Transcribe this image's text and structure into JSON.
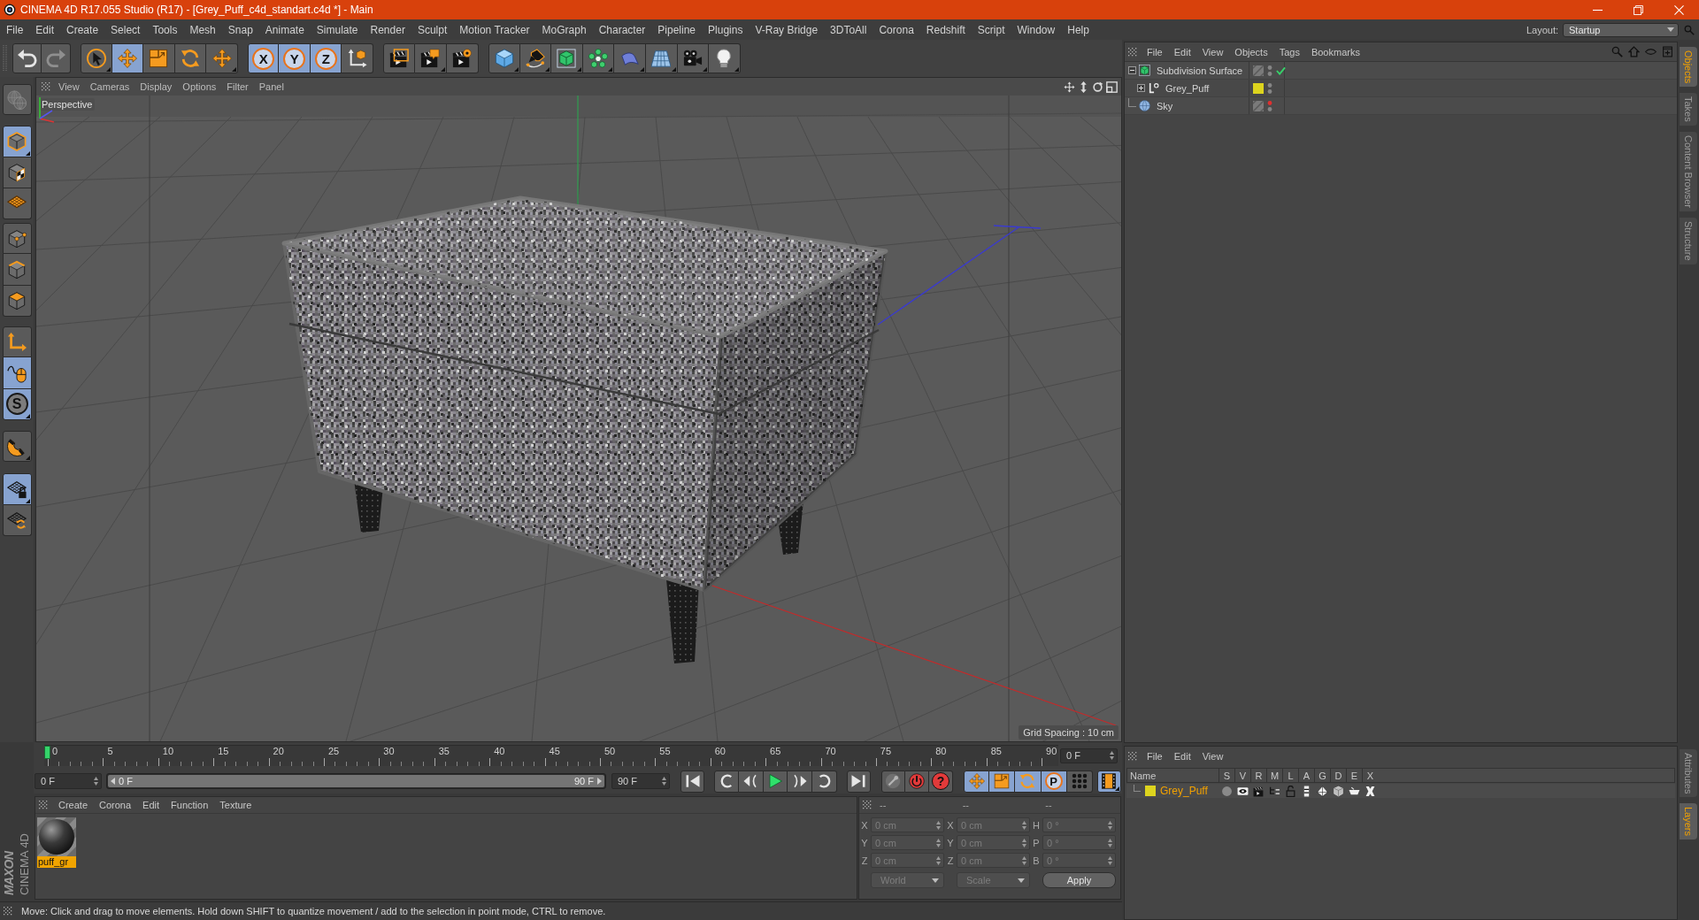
{
  "window": {
    "title": "CINEMA 4D R17.055 Studio (R17) - [Grey_Puff_c4d_standart.c4d *] - Main"
  },
  "menu_bar": {
    "items": [
      "File",
      "Edit",
      "Create",
      "Select",
      "Tools",
      "Mesh",
      "Snap",
      "Animate",
      "Simulate",
      "Render",
      "Sculpt",
      "Motion Tracker",
      "MoGraph",
      "Character",
      "Pipeline",
      "Plugins",
      "V-Ray Bridge",
      "3DToAll",
      "Corona",
      "Redshift",
      "Script",
      "Window",
      "Help"
    ],
    "layout_label": "Layout:",
    "layout_value": "Startup"
  },
  "toolbar": {
    "groups": [
      [
        {
          "active": false,
          "disabled": false
        },
        {
          "active": false,
          "disabled": true
        }
      ],
      [
        {
          "active": false
        },
        {
          "active": true
        },
        {
          "active": false
        },
        {
          "active": false
        },
        {
          "active": false
        }
      ],
      [
        {
          "glyph": "X",
          "active": true
        },
        {
          "glyph": "Y",
          "active": true
        },
        {
          "glyph": "Z",
          "active": true
        },
        {
          "active": false
        }
      ],
      [
        {
          "active": false
        },
        {
          "active": false
        },
        {
          "active": false
        }
      ],
      [
        {
          "active": false
        },
        {
          "active": false
        },
        {
          "active": false
        },
        {
          "active": false
        },
        {
          "active": false
        },
        {
          "active": false
        },
        {
          "active": false
        },
        {
          "active": false
        }
      ]
    ]
  },
  "left_toolbar": {
    "groups": [
      [
        {
          "active": false,
          "disabled": true
        }
      ],
      [
        {
          "active": true
        },
        {
          "active": false
        },
        {
          "active": false
        }
      ],
      [
        {
          "active": false
        },
        {
          "active": false
        },
        {
          "active": false
        }
      ],
      [
        {
          "active": false
        },
        {
          "active": true
        },
        {
          "glyph": "S",
          "active": true
        }
      ],
      [
        {
          "active": false
        }
      ],
      [
        {
          "active": true
        },
        {
          "active": false
        }
      ]
    ]
  },
  "viewport": {
    "menu": [
      "View",
      "Cameras",
      "Display",
      "Options",
      "Filter",
      "Panel"
    ],
    "camera": "Perspective",
    "grid_spacing": "Grid Spacing : 10 cm"
  },
  "object_manager": {
    "menu": [
      "File",
      "Edit",
      "View",
      "Objects",
      "Tags",
      "Bookmarks"
    ],
    "objects": [
      {
        "name": "Subdivision Surface",
        "kind": "subdivision",
        "expanded": true,
        "enabled": true,
        "hidden_in_editor": false,
        "children": [
          {
            "name": "Grey_Puff",
            "kind": "null",
            "expanded": false,
            "color": "#ddd41e",
            "hidden_in_editor": false
          }
        ]
      },
      {
        "name": "Sky",
        "kind": "sky",
        "hidden_in_editor": true
      }
    ]
  },
  "side_tabs": {
    "top": [
      {
        "label": "Objects",
        "selected": true
      },
      {
        "label": "Takes",
        "selected": false
      },
      {
        "label": "Content Browser",
        "selected": false
      },
      {
        "label": "Structure",
        "selected": false
      }
    ],
    "bottom": [
      {
        "label": "Attributes",
        "selected": false
      },
      {
        "label": "Layers",
        "selected": true
      }
    ]
  },
  "timeline": {
    "ticks": [
      "0",
      "5",
      "10",
      "15",
      "20",
      "25",
      "30",
      "35",
      "40",
      "45",
      "50",
      "55",
      "60",
      "65",
      "70",
      "75",
      "80",
      "85",
      "90"
    ],
    "playhead": {
      "level": 0
    },
    "current_frame": "0 F"
  },
  "transport": {
    "start_frame": "0 F",
    "range": {
      "start": "0 F",
      "end": "90 F",
      "level": 1
    },
    "end_frame": "90 F",
    "groups": [
      [
        {
          "active": false
        }
      ],
      [
        {
          "active": false
        },
        {
          "active": false
        },
        {
          "active": false
        },
        {
          "active": false
        },
        {
          "active": false
        }
      ],
      [
        {
          "active": false
        }
      ],
      [
        {
          "active": false
        },
        {
          "active": false
        },
        {
          "glyph": "?",
          "active": false
        }
      ],
      [
        {
          "active": true
        },
        {
          "active": true
        },
        {
          "active": true
        },
        {
          "glyph": "P",
          "active": true
        },
        {
          "active": false
        }
      ],
      [
        {
          "active": true
        }
      ]
    ]
  },
  "material_manager": {
    "menu": [
      "Create",
      "Corona",
      "Edit",
      "Function",
      "Texture"
    ],
    "materials": [
      {
        "name": "puff_gr",
        "selected": true
      }
    ]
  },
  "coordinates": {
    "headers": [
      "--",
      "--",
      "--"
    ],
    "disabled": true,
    "rows": [
      [
        {
          "axis": "X",
          "value": "0 cm"
        },
        {
          "axis": "X",
          "value": "0 cm"
        },
        {
          "axis": "H",
          "value": "0 °"
        }
      ],
      [
        {
          "axis": "Y",
          "value": "0 cm"
        },
        {
          "axis": "Y",
          "value": "0 cm"
        },
        {
          "axis": "P",
          "value": "0 °"
        }
      ],
      [
        {
          "axis": "Z",
          "value": "0 cm"
        },
        {
          "axis": "Z",
          "value": "0 cm"
        },
        {
          "axis": "B",
          "value": "0 °"
        }
      ]
    ],
    "dropdowns": [
      "World",
      "Scale"
    ],
    "apply_button": "Apply"
  },
  "logo": {
    "brand": "MAXON",
    "product": "CINEMA 4D"
  },
  "layer_manager": {
    "menu": [
      "File",
      "Edit",
      "View"
    ],
    "columns": [
      "Name",
      "S",
      "V",
      "R",
      "M",
      "L",
      "A",
      "G",
      "D",
      "E",
      "X"
    ],
    "layers": [
      {
        "name": "Grey_Puff",
        "color": "#ddd41e",
        "selected": true
      }
    ]
  },
  "status_bar": {
    "message": "Move: Click and drag to move elements. Hold down SHIFT to quantize movement / add to the selection in point mode, CTRL to remove."
  }
}
